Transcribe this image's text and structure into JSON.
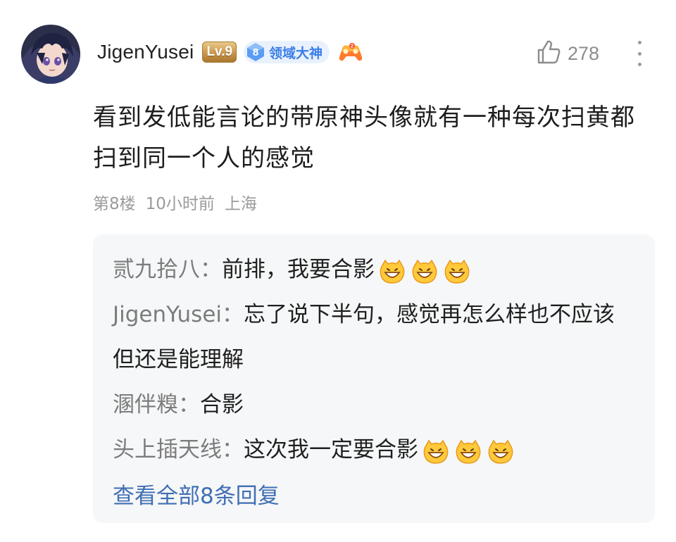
{
  "comment": {
    "username": "JigenYusei",
    "level_badge": "Lv.9",
    "domain_badge": {
      "level": "8",
      "label": "领域大神"
    },
    "like_icon": "thumbs-up-icon",
    "like_count": "278",
    "more_icon": "more-vertical-icon",
    "text": "看到发低能言论的带原神头像就有一种每次扫黄都扫到同一个人的感觉",
    "meta": {
      "floor": "第8楼",
      "time": "10小时前",
      "location": "上海"
    }
  },
  "replies": [
    {
      "author": "贰九拾八",
      "separator": "：",
      "text": "前排，我要合影",
      "emoji_count": 3,
      "emoji": "grin-emoji"
    },
    {
      "author": "JigenYusei",
      "separator": "：",
      "text": "忘了说下半句，感觉再怎么样也不应该但还是能理解",
      "emoji_count": 0
    },
    {
      "author": "溷伴糗",
      "separator": "：",
      "text": "合影",
      "emoji_count": 0
    },
    {
      "author": "头上插天线",
      "separator": "：",
      "text": "这次我一定要合影",
      "emoji_count": 3,
      "emoji": "grin-emoji"
    }
  ],
  "view_all_label": "查看全部8条回复",
  "colors": {
    "link": "#3f6fb4",
    "badge_blue": "#3a7ee8",
    "reply_bg": "#f6f7f8",
    "muted": "#9b9b9b"
  }
}
